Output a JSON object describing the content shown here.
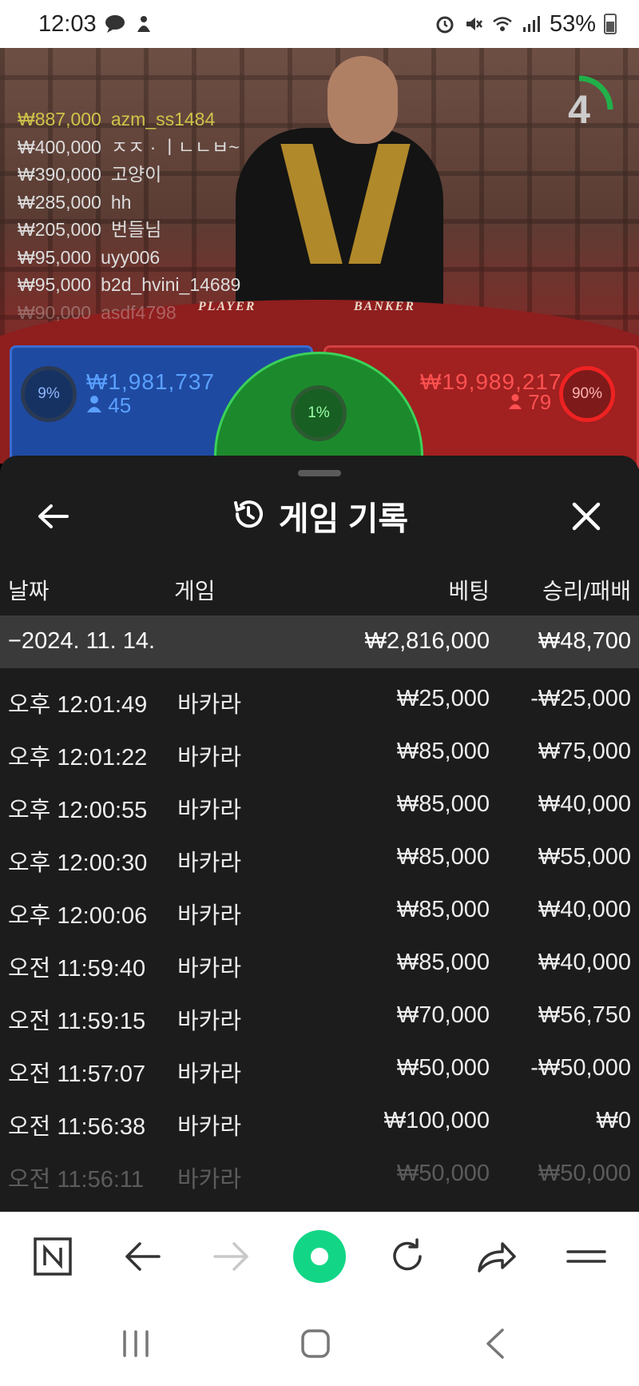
{
  "status_bar": {
    "time": "12:03",
    "battery": "53%",
    "icons": [
      "chat-bubble-icon",
      "notification-icon",
      "alarm-icon",
      "mute-icon",
      "wifi-icon",
      "signal-icon",
      "battery-icon"
    ]
  },
  "live": {
    "countdown": "4",
    "bets": [
      {
        "amount": "₩887,000",
        "user": "azm_ss1484"
      },
      {
        "amount": "₩400,000",
        "user": "ㅈㅈ · ㅣㄴㄴㅂ~"
      },
      {
        "amount": "₩390,000",
        "user": "고양이"
      },
      {
        "amount": "₩285,000",
        "user": "hh"
      },
      {
        "amount": "₩205,000",
        "user": "번들님"
      },
      {
        "amount": "₩95,000",
        "user": "uyy006"
      },
      {
        "amount": "₩95,000",
        "user": "b2d_hvini_14689"
      },
      {
        "amount": "₩90,000",
        "user": "asdf4798"
      }
    ],
    "table_player_label": "PLAYER",
    "table_banker_label": "BANKER",
    "player": {
      "percent": "9%",
      "amount": "₩1,981,737",
      "count": "45"
    },
    "banker": {
      "percent": "90%",
      "amount": "₩19,989,217",
      "count": "79"
    },
    "tie": {
      "percent": "1%"
    }
  },
  "history": {
    "title": "게임 기록",
    "columns": {
      "date": "날짜",
      "game": "게임",
      "bet": "베팅",
      "result": "승리/패배"
    },
    "summary": {
      "date": "−2024. 11. 14.",
      "bet": "₩2,816,000",
      "result": "₩48,700"
    },
    "rows": [
      {
        "time": "오후 12:01:49",
        "game": "바카라",
        "bet": "₩25,000",
        "result": "-₩25,000"
      },
      {
        "time": "오후 12:01:22",
        "game": "바카라",
        "bet": "₩85,000",
        "result": "₩75,000"
      },
      {
        "time": "오후 12:00:55",
        "game": "바카라",
        "bet": "₩85,000",
        "result": "₩40,000"
      },
      {
        "time": "오후 12:00:30",
        "game": "바카라",
        "bet": "₩85,000",
        "result": "₩55,000"
      },
      {
        "time": "오후 12:00:06",
        "game": "바카라",
        "bet": "₩85,000",
        "result": "₩40,000"
      },
      {
        "time": "오전 11:59:40",
        "game": "바카라",
        "bet": "₩85,000",
        "result": "₩40,000"
      },
      {
        "time": "오전 11:59:15",
        "game": "바카라",
        "bet": "₩70,000",
        "result": "₩56,750"
      },
      {
        "time": "오전 11:57:07",
        "game": "바카라",
        "bet": "₩50,000",
        "result": "-₩50,000"
      },
      {
        "time": "오전 11:56:38",
        "game": "바카라",
        "bet": "₩100,000",
        "result": "₩0"
      },
      {
        "time": "오전 11:56:11",
        "game": "바카라",
        "bet": "₩50,000",
        "result": "₩50,000"
      }
    ]
  },
  "colors": {
    "accent_green": "#12d686",
    "player_blue": "#1f4aa1",
    "banker_red": "#a12020",
    "sheet_bg": "#1c1c1c"
  }
}
